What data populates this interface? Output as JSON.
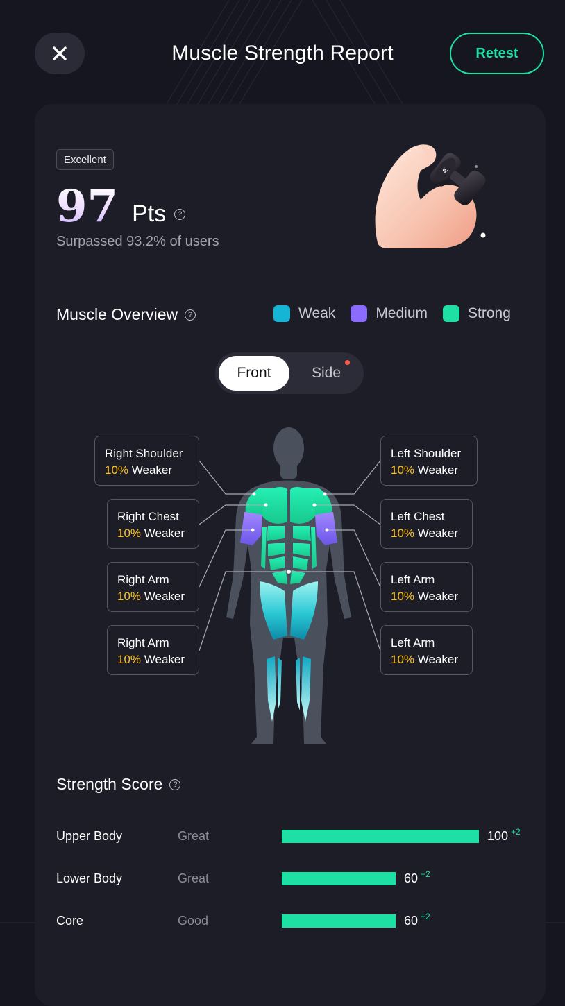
{
  "header": {
    "title": "Muscle Strength Report",
    "retest_label": "Retest"
  },
  "summary": {
    "badge": "Excellent",
    "score": "97",
    "unit": "Pts",
    "surpassed_text": "Surpassed 93.2% of users"
  },
  "overview": {
    "title": "Muscle Overview",
    "legend": [
      {
        "label": "Weak",
        "color": "#16b5d6"
      },
      {
        "label": "Medium",
        "color": "#8c6cff"
      },
      {
        "label": "Strong",
        "color": "#1ee0a4"
      }
    ],
    "view_tabs": {
      "front": "Front",
      "side": "Side",
      "selected": "Front"
    },
    "labels_right_side": [
      {
        "name": "Right Shoulder",
        "percent": "10%",
        "status": "Weaker"
      },
      {
        "name": "Right Chest",
        "percent": "10%",
        "status": "Weaker"
      },
      {
        "name": "Right Arm",
        "percent": "10%",
        "status": "Weaker"
      },
      {
        "name": "Right Arm",
        "percent": "10%",
        "status": "Weaker"
      }
    ],
    "labels_left_side": [
      {
        "name": "Left Shoulder",
        "percent": "10%",
        "status": "Weaker"
      },
      {
        "name": "Left Chest",
        "percent": "10%",
        "status": "Weaker"
      },
      {
        "name": "Left Arm",
        "percent": "10%",
        "status": "Weaker"
      },
      {
        "name": "Left Arm",
        "percent": "10%",
        "status": "Weaker"
      }
    ]
  },
  "strength": {
    "title": "Strength Score",
    "max_value": 100,
    "rows": [
      {
        "name": "Upper Body",
        "level": "Great",
        "value": 100,
        "value_text": "100",
        "delta": "+2"
      },
      {
        "name": "Lower Body",
        "level": "Great",
        "value": 60,
        "value_text": "60",
        "delta": "+2"
      },
      {
        "name": "Core",
        "level": "Good",
        "value": 60,
        "value_text": "60",
        "delta": "+2"
      }
    ]
  },
  "colors": {
    "accent": "#1ee0a4",
    "background": "#15161f",
    "card": "#1c1d27",
    "highlight_percent": "#ffc21a"
  },
  "icons": {
    "close": "close-icon",
    "help": "help-icon",
    "hero": "flexed-arm-dumbbell-icon"
  }
}
